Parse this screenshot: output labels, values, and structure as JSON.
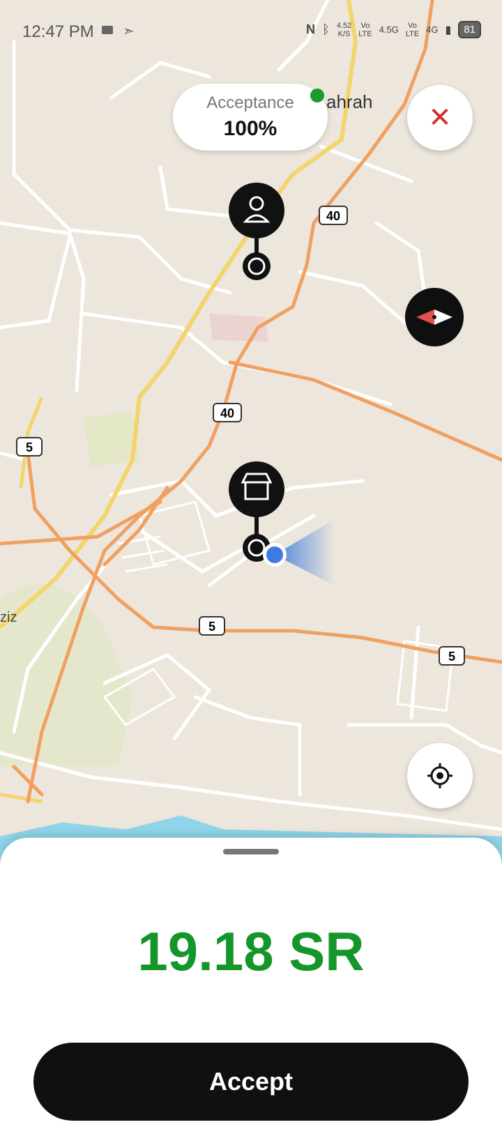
{
  "status": {
    "time": "12:47 PM",
    "net_speed_value": "4.52",
    "net_speed_unit": "K/S",
    "sim1_top": "Vo",
    "sim1_bottom": "LTE",
    "sim1_type": "4.5G",
    "sim2_top": "Vo",
    "sim2_bottom": "LTE",
    "sim2_type": "4G",
    "battery": "81"
  },
  "acceptance": {
    "label": "Acceptance",
    "value": "100%"
  },
  "map": {
    "place_label_1": "ahrah",
    "place_label_2": "ziz",
    "road_40_a": "40",
    "road_40_b": "40",
    "road_5_a": "5",
    "road_5_b": "5",
    "road_5_c": "5"
  },
  "offer": {
    "price": "19.18 SR",
    "accept_label": "Accept"
  },
  "colors": {
    "price_green": "#14962a",
    "primary": "#101010",
    "close_red": "#d03030"
  }
}
